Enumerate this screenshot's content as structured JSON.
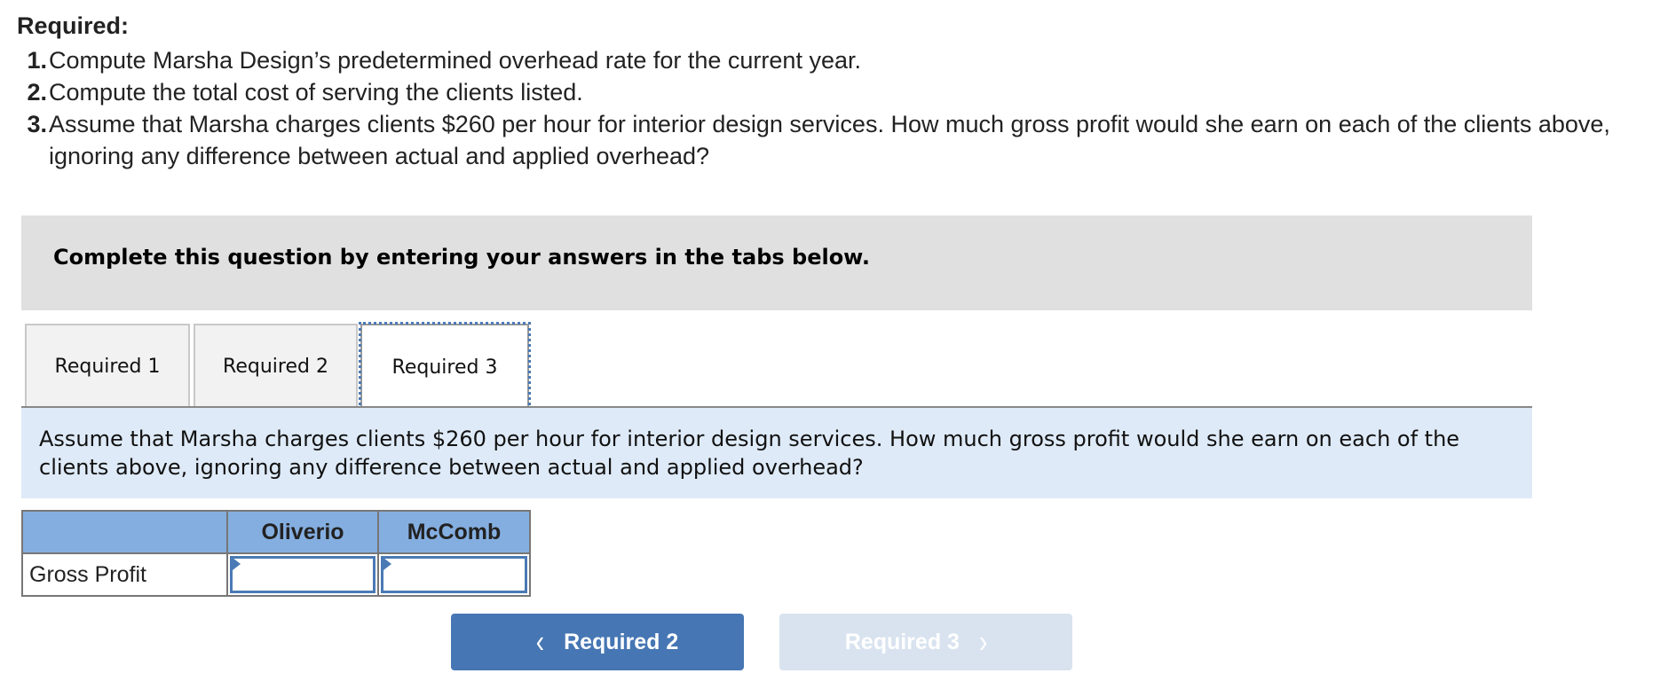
{
  "required": {
    "title": "Required:",
    "items": [
      {
        "num": "1.",
        "text": "Compute Marsha Design’s predetermined overhead rate for the current year."
      },
      {
        "num": "2.",
        "text": "Compute the total cost of serving the clients listed."
      },
      {
        "num": "3.",
        "text": "Assume that Marsha charges clients $260 per hour for interior design services. How much gross profit would she earn on each of the clients above, ignoring any difference between actual and applied overhead?"
      }
    ]
  },
  "instruction": "Complete this question by entering your answers in the tabs below.",
  "tabs": [
    {
      "label": "Required 1",
      "active": false
    },
    {
      "label": "Required 2",
      "active": false
    },
    {
      "label": "Required 3",
      "active": true
    }
  ],
  "prompt": "Assume that Marsha charges clients $260 per hour for interior design services. How much gross profit would she earn on each of the clients above, ignoring any difference between actual and applied overhead?",
  "table": {
    "headers": [
      "",
      "Oliverio",
      "McComb"
    ],
    "rows": [
      {
        "label": "Gross Profit",
        "values": [
          "",
          ""
        ]
      }
    ]
  },
  "navigation": {
    "prev_label": "Required 2",
    "next_label": "Required 3",
    "next_disabled": true
  },
  "colors": {
    "accent": "#4676b3",
    "header_fill": "#84aee0",
    "prompt_fill": "#deeaf7",
    "instruction_fill": "#e0e0e0",
    "disabled_button": "#d9e3ef"
  }
}
